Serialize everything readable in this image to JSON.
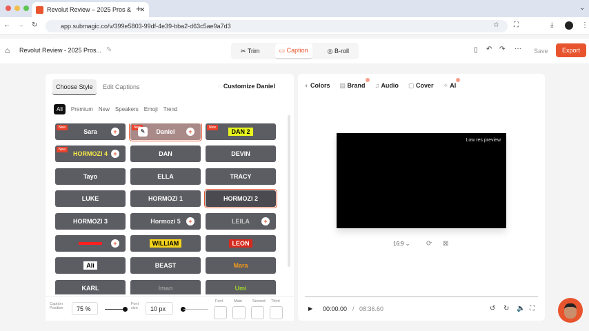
{
  "browser": {
    "tab_title": "Revolut Review – 2025 Pros &",
    "url": "app.submagic.co/v/399e5803-99df-4e39-bba2-d63c5ae9a7d3"
  },
  "header": {
    "project_title": "Revolut Review - 2025 Pros...",
    "tabs": [
      {
        "label": "Trim",
        "icon": "scissors-icon"
      },
      {
        "label": "Caption",
        "icon": "caption-icon"
      },
      {
        "label": "B-roll",
        "icon": "broll-icon"
      }
    ],
    "save": "Save",
    "export": "Export",
    "accent": "#e8542d"
  },
  "left": {
    "tabs": [
      "Choose Style",
      "Edit Captions"
    ],
    "customize": "Customize Daniel",
    "filters": [
      "All",
      "Premium",
      "New",
      "Speakers",
      "Emoji",
      "Trend"
    ],
    "styles": [
      {
        "name": "Sara",
        "new": true,
        "plus": true,
        "color": "#ffffff"
      },
      {
        "name": "Daniel",
        "new": true,
        "plus": true,
        "selected": true,
        "edit": true,
        "color": "#ffffff"
      },
      {
        "name": "DAN 2",
        "new": true,
        "color": "#000000",
        "bg": "#e8f51c"
      },
      {
        "name": "HORMOZI 4",
        "new": true,
        "plus": true,
        "color": "#f4e84a"
      },
      {
        "name": "DAN",
        "color": "#ffffff"
      },
      {
        "name": "DEVIN",
        "color": "#ffffff"
      },
      {
        "name": "Tayo",
        "color": "#ffffff"
      },
      {
        "name": "ELLA",
        "color": "#ffffff"
      },
      {
        "name": "TRACY",
        "color": "#ffffff"
      },
      {
        "name": "LUKE",
        "color": "#ffffff"
      },
      {
        "name": "HORMOZI 1",
        "color": "#ffffff"
      },
      {
        "name": "HORMOZI 2",
        "color": "#ffffff",
        "outlined": true
      },
      {
        "name": "HORMOZI 3",
        "color": "#ffffff"
      },
      {
        "name": "Hormozi 5",
        "plus": true,
        "color": "#eeeeee"
      },
      {
        "name": "LEILA",
        "plus": true,
        "color": "#cccccc"
      },
      {
        "name": "",
        "plus": true,
        "color": "#ff2020"
      },
      {
        "name": "WILLIAM",
        "color": "#000000",
        "bg": "#f5d31c"
      },
      {
        "name": "LEON",
        "color": "#ffffff",
        "bg": "#d62a1e"
      },
      {
        "name": "Ali",
        "color": "#000000",
        "bg": "#ffffff"
      },
      {
        "name": "BEAST",
        "color": "#ffffff"
      },
      {
        "name": "Mara",
        "color": "#f39a1b"
      },
      {
        "name": "KARL",
        "color": "#ffffff"
      },
      {
        "name": "Iman",
        "color": "#999999"
      },
      {
        "name": "Umi",
        "color": "#9acd32"
      }
    ],
    "footer": {
      "caption_position_label": "Caption Position",
      "caption_position": "75",
      "percent": "%",
      "font_size_label": "Font size",
      "font_size": "10",
      "px": "px",
      "swatches": [
        "Font",
        "Main",
        "Second",
        "Third"
      ]
    }
  },
  "right": {
    "tabs": [
      {
        "label": "Colors",
        "icon": "palette-icon"
      },
      {
        "label": "Brand",
        "icon": "brand-icon"
      },
      {
        "label": "Audio",
        "icon": "music-icon"
      },
      {
        "label": "Cover",
        "icon": "image-icon"
      },
      {
        "label": "AI",
        "icon": "sparkle-icon"
      }
    ],
    "preview_note": "Low res preview",
    "aspect": "16:9",
    "time_current": "00:00.00",
    "time_sep": "/",
    "time_total": "08:36.60"
  }
}
